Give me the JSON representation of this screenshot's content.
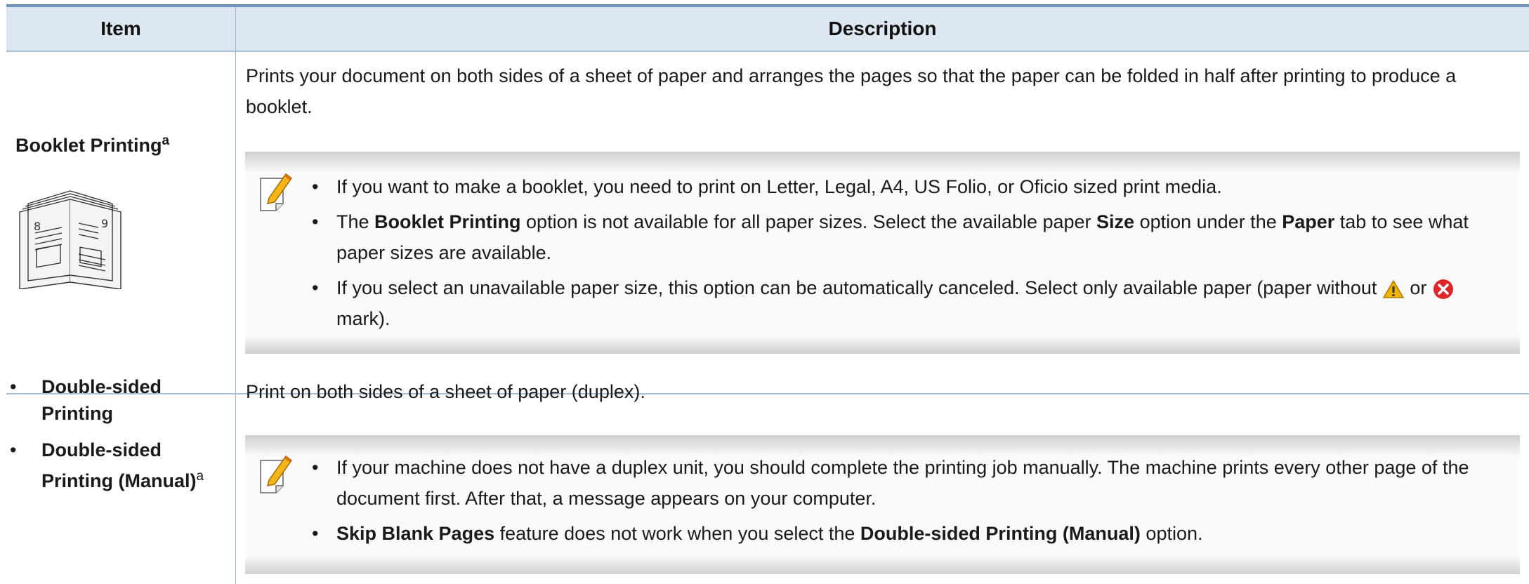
{
  "table": {
    "headers": {
      "item": "Item",
      "description": "Description"
    },
    "rows": [
      {
        "item_title": "Booklet Printing",
        "item_sup": "a",
        "book_digits": [
          "8",
          "9"
        ],
        "description": "Prints your document on both sides of a sheet of paper and arranges the pages so that the paper can be folded in half after printing to produce a booklet.",
        "note": {
          "icon": "note-pencil-icon",
          "bullets": [
            {
              "text": "If you want to make a booklet, you need to print on Letter, Legal, A4, US Folio, or Oficio sized print media."
            },
            {
              "pre": "The ",
              "b1": "Booklet Printing",
              "mid1": " option is not available for all paper sizes. Select the available paper ",
              "b2": "Size",
              "mid2": " option under the ",
              "b3": "Paper",
              "post": " tab to see what paper sizes are available."
            },
            {
              "pre": "If you select an unavailable paper size, this option can be automatically canceled. Select only available paper (paper without ",
              "mid": " or ",
              "post": " mark).",
              "icons": [
                "warning-icon",
                "error-icon"
              ]
            }
          ]
        }
      },
      {
        "items": [
          {
            "label": "Double-sided Printing"
          },
          {
            "label": "Double-sided Printing (Manual)",
            "sup": "a"
          }
        ],
        "description": "Print on both sides of a sheet of paper (duplex).",
        "note": {
          "icon": "note-pencil-icon",
          "bullets": [
            {
              "text": "If your machine does not have a duplex unit, you should complete the printing job manually. The machine prints every other page of the document first. After that, a message appears on your computer."
            },
            {
              "b1": "Skip Blank Pages",
              "mid1": " feature does not work when you select the ",
              "b2": "Double-sided Printing (Manual)",
              "post": " option."
            }
          ]
        }
      }
    ]
  },
  "bullet_char": "•",
  "colors": {
    "header_bg": "#dde7f1",
    "rule": "#6d93b8",
    "warning": "#f0b400",
    "error": "#e0262b"
  }
}
